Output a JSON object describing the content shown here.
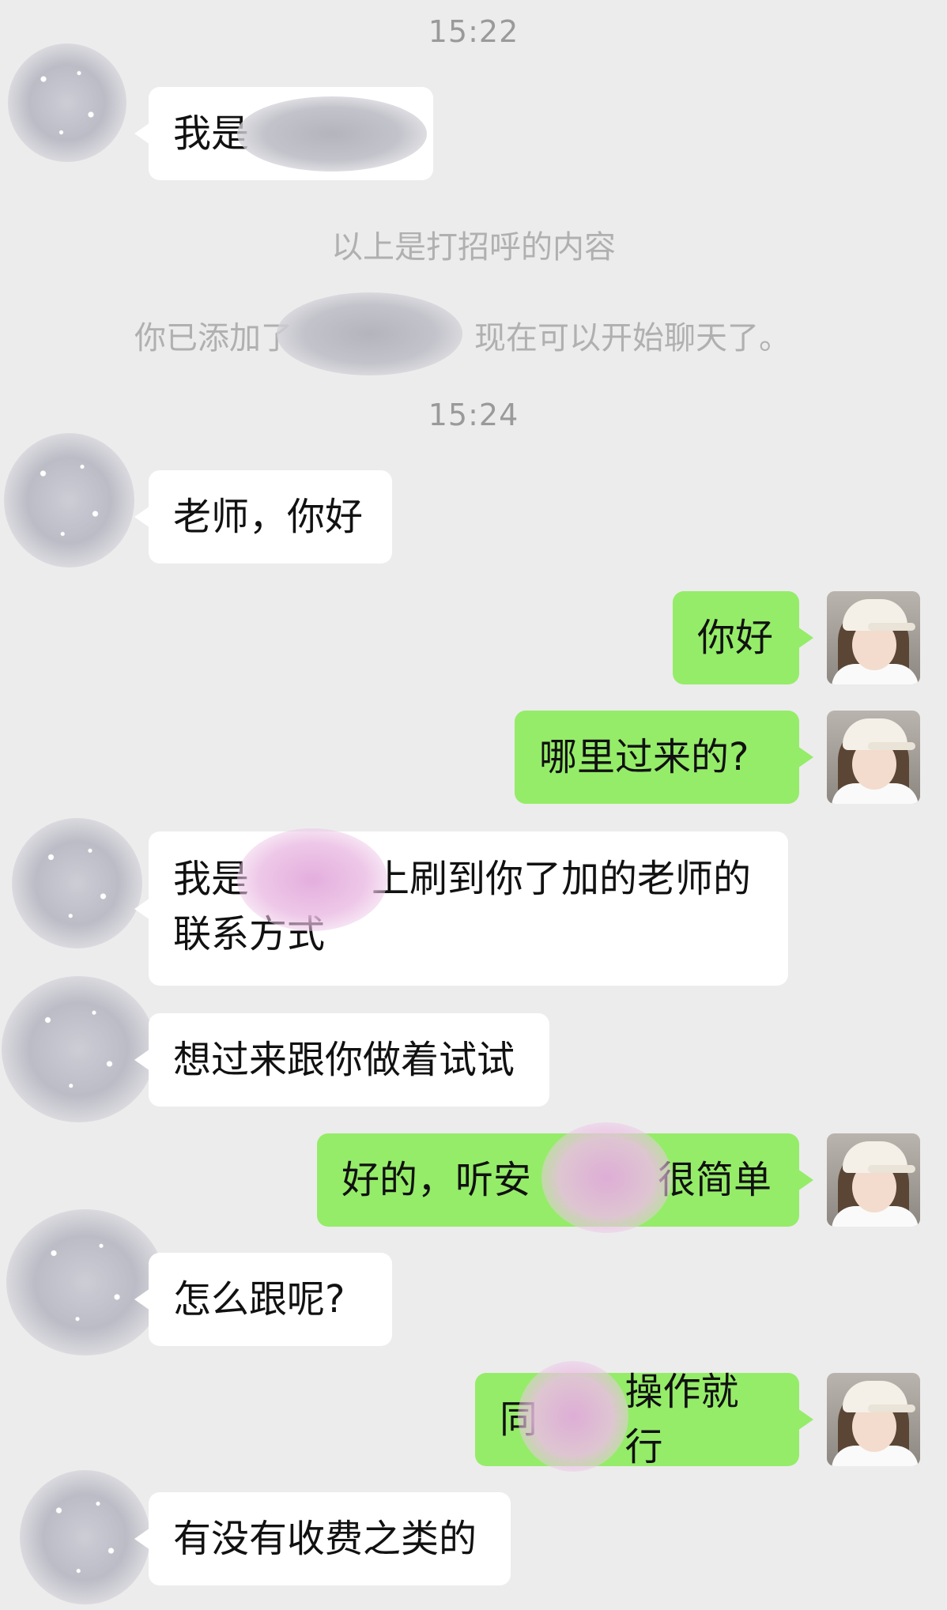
{
  "chat": {
    "timestamps": [
      "15:22",
      "15:24"
    ],
    "system_messages": [
      "以上是打招呼的内容",
      "你已添加了",
      "现在可以开始聊天了。"
    ],
    "messages": [
      {
        "side": "left",
        "text": "我是"
      },
      {
        "side": "left",
        "text": "老师，你好"
      },
      {
        "side": "right",
        "text": "你好"
      },
      {
        "side": "right",
        "text": "哪里过来的?"
      },
      {
        "side": "left",
        "text": "我是",
        "text2": "上刷到你了加的老师的",
        "text3": "联系方式"
      },
      {
        "side": "left",
        "text": "想过来跟你做着试试"
      },
      {
        "side": "right",
        "text": "好的，听安",
        "text2": "很简单"
      },
      {
        "side": "left",
        "text": "怎么跟呢?"
      },
      {
        "side": "right",
        "text": "同",
        "text2": "操作就行"
      },
      {
        "side": "left",
        "text": "有没有收费之类的"
      }
    ]
  },
  "colors": {
    "background": "#ececec",
    "bubble_left": "#ffffff",
    "bubble_right": "#95ec69",
    "timestamp_text": "#9a9a9a"
  }
}
